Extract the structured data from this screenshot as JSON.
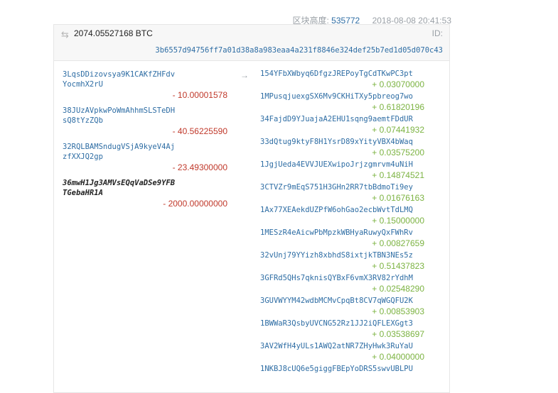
{
  "meta": {
    "height_label": "区块高度:",
    "height_value": "535772",
    "time": "2018-08-08 20:41:53"
  },
  "tx": {
    "amount": "2074.05527168 BTC",
    "id_label": "ID:",
    "txid": "3b6557d94756ff7a01d38a8a983eaa4a231f8846e324def25b7ed1d05d070c43",
    "arrow": "→"
  },
  "inputs": [
    {
      "address": "3LqsDDizovsya9K1CAKfZHFdvYocmhX2rU",
      "amount": "- 10.00001578"
    },
    {
      "address": "38JUzAVpkwPoWmAhhmSLSTeDHsQ8tYzZQb",
      "amount": "- 40.56225590"
    },
    {
      "address": "32RQLBAMSndugVSjA9kyeV4AjzfXXJQ2gp",
      "amount": "- 23.49300000"
    },
    {
      "address": "36mwH1Jg3AMVsEQqVaDSe9YFBTGebaHR1A",
      "amount": "- 2000.00000000"
    }
  ],
  "outputs": [
    {
      "address": "154YFbXWbyq6DfgzJREPoyTgCdTKwPC3pt",
      "amount": "+ 0.03070000"
    },
    {
      "address": "1MPusqjuexgSX6Mv9CKHiTXy5pbreog7wo",
      "amount": "+ 0.61820196"
    },
    {
      "address": "34FajdD9YJuajaA2EHU1sqng9aemtFDdUR",
      "amount": "+ 0.07441932"
    },
    {
      "address": "33dQtug9ktyF8H1YsrD89xYityVBX4bWaq",
      "amount": "+ 0.03575200"
    },
    {
      "address": "1JgjUeda4EVVJUEXwipoJrjzgmrvm4uNiH",
      "amount": "+ 0.14874521"
    },
    {
      "address": "3CTVZr9mEqS751H3GHn2RR7tbBdmoTi9ey",
      "amount": "+ 0.01676163"
    },
    {
      "address": "1Ax77XEAekdUZPfW6ohGao2ecbWvtTdLMQ",
      "amount": "+ 0.15000000"
    },
    {
      "address": "1MESzR4eAicwPbMpzkWBHyaRuwyQxFWhRv",
      "amount": "+ 0.00827659"
    },
    {
      "address": "32vUnj79YYizh8xbhdS8ixtjkTBN3NEs5z",
      "amount": "+ 0.51437823"
    },
    {
      "address": "3GFRd5QHs7qknisQYBxF6vmX3RV82rYdhM",
      "amount": "+ 0.02548290"
    },
    {
      "address": "3GUVWYYM42wdbMCMvCpqBt8CV7qWGQFU2K",
      "amount": "+ 0.00853903"
    },
    {
      "address": "1BWWaR3QsbyUVCNG52Rz1JJ2iQFLEXGgt3",
      "amount": "+ 0.03538697"
    },
    {
      "address": "3AV2WfH4yULs1AWQ2atNR7ZHyHwk3RuYaU",
      "amount": "+ 0.04000000"
    },
    {
      "address": "1NKBJ8cUQ6e5giggFBEpYoDRS5swvUBLPU",
      "amount": ""
    }
  ]
}
